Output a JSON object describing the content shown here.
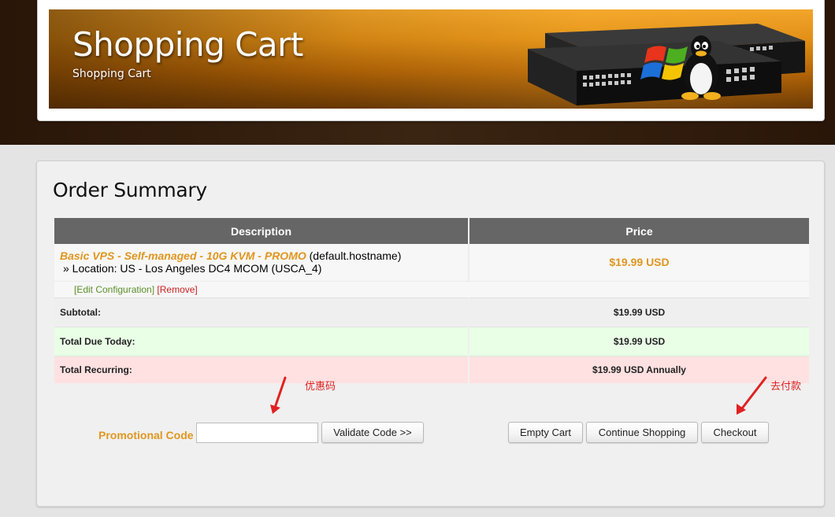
{
  "banner": {
    "title": "Shopping Cart",
    "subtitle": "Shopping Cart"
  },
  "summary": {
    "heading": "Order Summary",
    "columns": [
      "Description",
      "Price"
    ],
    "item": {
      "name_italic": "Basic VPS - Self-managed",
      "name_promo": " - 10G KVM - PROMO",
      "hostname": " (default.hostname)",
      "location": "» Location: US - Los Angeles DC4 MCOM (USCA_4)",
      "price": "$19.99 USD",
      "edit_label": "[Edit Configuration]",
      "remove_label": "[Remove]"
    },
    "totals": {
      "subtotal_label": "Subtotal:",
      "subtotal_value": "$19.99 USD",
      "due_label": "Total Due Today:",
      "due_value": "$19.99 USD",
      "recurring_label": "Total Recurring:",
      "recurring_value": "$19.99 USD Annually"
    }
  },
  "annotations": {
    "promo_note": "优惠码",
    "checkout_note": "去付款"
  },
  "promo": {
    "label": "Promotional Code",
    "input_value": "",
    "validate_label": "Validate Code >>"
  },
  "actions": {
    "empty_label": "Empty Cart",
    "continue_label": "Continue Shopping",
    "checkout_label": "Checkout"
  },
  "colors": {
    "accent_orange": "#e0961f",
    "header_gray": "#666666",
    "due_green": "#e9ffe6",
    "recurring_pink": "#ffe1e1",
    "annotation_red": "#e02121"
  },
  "icons": [
    "network-switch-illustration",
    "windows-logo-icon",
    "tux-penguin-icon",
    "red-arrow-icon"
  ]
}
